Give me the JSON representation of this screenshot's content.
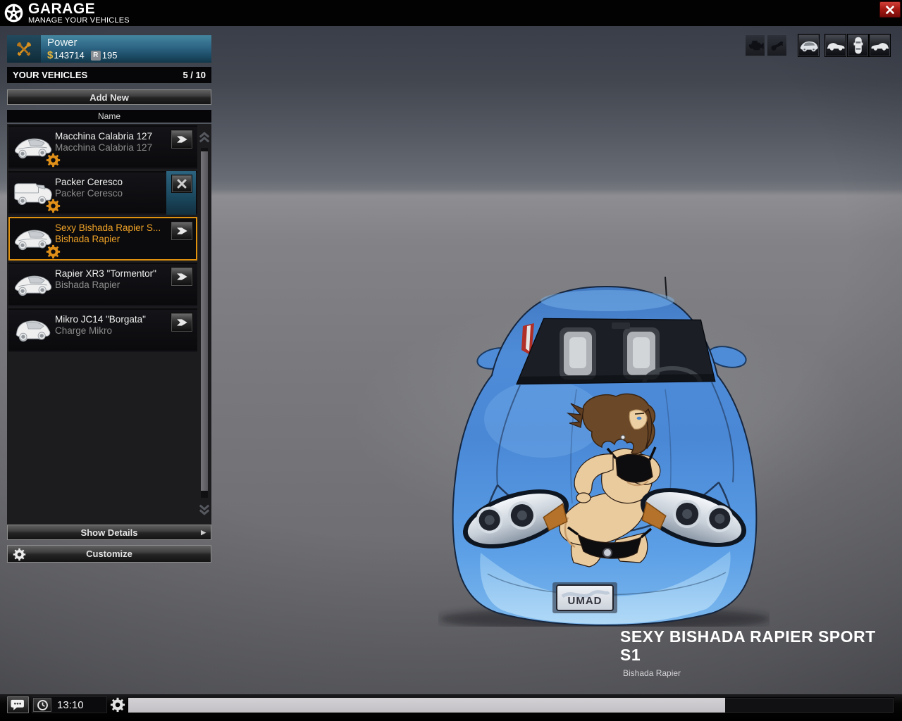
{
  "header": {
    "title": "GARAGE",
    "subtitle": "MANAGE YOUR VEHICLES"
  },
  "wallet": {
    "name": "Power",
    "currency_symbol": "$",
    "cash": "143714",
    "rating_symbol": "R",
    "rating": "195"
  },
  "vehicles": {
    "header": "YOUR VEHICLES",
    "count": "5 / 10",
    "add_new_label": "Add New",
    "column_header": "Name",
    "items": [
      {
        "title": "Macchina Calabria 127",
        "subtitle": "Macchina Calabria 127"
      },
      {
        "title": "Packer Ceresco",
        "subtitle": "Packer Ceresco"
      },
      {
        "title": "Sexy Bishada Rapier S...",
        "subtitle": "Bishada Rapier"
      },
      {
        "title": "Rapier XR3 \"Tormentor\"",
        "subtitle": "Bishada Rapier"
      },
      {
        "title": "Mikro JC14 \"Borgata\"",
        "subtitle": "Charge Mikro"
      }
    ],
    "show_details_label": "Show Details",
    "show_details_arrow": "▶",
    "customize_label": "Customize"
  },
  "viewer": {
    "vehicle_title": "SEXY BISHADA RAPIER SPORT S1",
    "vehicle_subtitle": "Bishada Rapier",
    "license_plate": "UMAD"
  },
  "statusbar": {
    "time": "13:10",
    "progress_percent": 78
  },
  "toolbar_icons": [
    "engine-icon",
    "horn-icon",
    "view-3d-icon",
    "view-side-icon",
    "view-top-icon",
    "view-side-alt-icon"
  ],
  "colors": {
    "accent_orange": "#f0a226",
    "selection_teal": "#1e4c64",
    "close_red": "#a81a14",
    "car_blue": "#4e8cd8"
  }
}
